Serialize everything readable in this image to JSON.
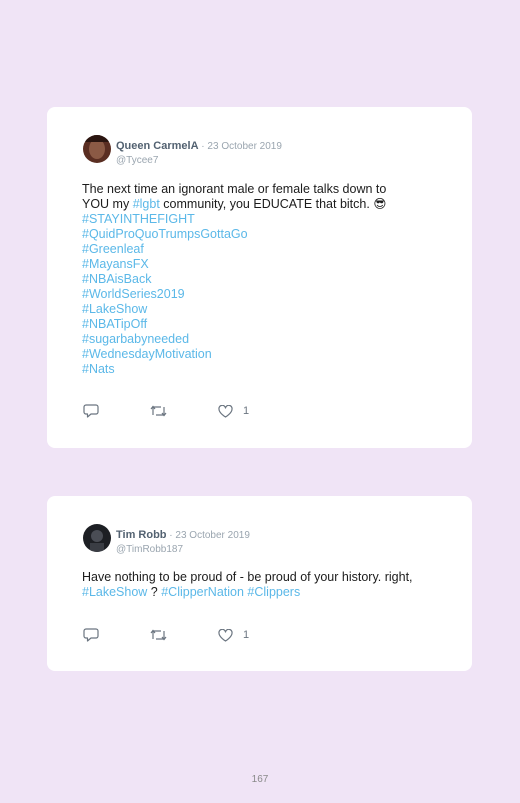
{
  "posts": [
    {
      "author": "Queen CarmelA",
      "separator": " · ",
      "date": "23 October 2019",
      "handle": "@Tycee7",
      "text_line1": "The next time an ignorant male or female talks down to",
      "text_line2_pre": "YOU my ",
      "text_line2_tag": "#lgbt",
      "text_line2_post": " community, you EDUCATE that bitch. ",
      "emoji": "😎",
      "hashtags": [
        "#STAYINTHEFIGHT",
        "#QuidProQuoTrumpsGottaGo",
        "#Greenleaf",
        "#MayansFX",
        "#NBAisBack",
        "#WorldSeries2019",
        "#LakeShow",
        "#NBATipOff",
        "#sugarbabyneeded",
        "#WednesdayMotivation",
        "#Nats"
      ],
      "likes": "1"
    },
    {
      "author": "Tim Robb",
      "separator": " · ",
      "date": "23 October 2019",
      "handle": "@TimRobb187",
      "text_line1": "Have nothing to be proud of - be proud of your history. right,",
      "tag1": "#LakeShow",
      "mid": " ? ",
      "tag2": "#ClipperNation",
      "tag3": "#Clippers",
      "likes": "1"
    }
  ],
  "page_number": "167",
  "colors": {
    "background": "#f0e4f6",
    "card": "#ffffff",
    "hashtag": "#5bb8e8",
    "author": "#536271",
    "muted": "#9aa5af"
  },
  "icons": [
    "reply-icon",
    "retweet-icon",
    "heart-icon"
  ]
}
